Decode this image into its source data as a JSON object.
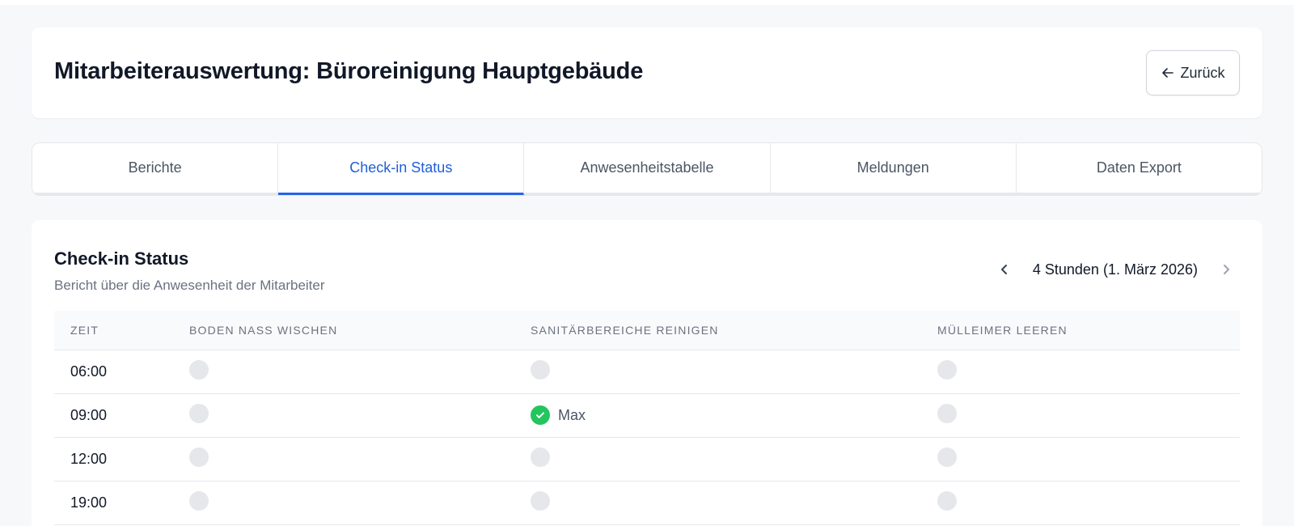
{
  "header": {
    "title": "Mitarbeiterauswertung: Büroreinigung Hauptgebäude",
    "back_label": "Zurück"
  },
  "tabs": [
    {
      "label": "Berichte",
      "active": false
    },
    {
      "label": "Check-in Status",
      "active": true
    },
    {
      "label": "Anwesenheitstabelle",
      "active": false
    },
    {
      "label": "Meldungen",
      "active": false
    },
    {
      "label": "Daten Export",
      "active": false
    }
  ],
  "section": {
    "title": "Check-in Status",
    "subtitle": "Bericht über die Anwesenheit der Mitarbeiter",
    "period_label": "4 Stunden (1. März 2026)"
  },
  "table": {
    "columns": [
      "ZEIT",
      "BODEN NASS WISCHEN",
      "SANITÄRBEREICHE REINIGEN",
      "MÜLLEIMER LEEREN"
    ],
    "rows": [
      {
        "time": "06:00",
        "cells": [
          {
            "done": false,
            "name": ""
          },
          {
            "done": false,
            "name": ""
          },
          {
            "done": false,
            "name": ""
          }
        ]
      },
      {
        "time": "09:00",
        "cells": [
          {
            "done": false,
            "name": ""
          },
          {
            "done": true,
            "name": "Max"
          },
          {
            "done": false,
            "name": ""
          }
        ]
      },
      {
        "time": "12:00",
        "cells": [
          {
            "done": false,
            "name": ""
          },
          {
            "done": false,
            "name": ""
          },
          {
            "done": false,
            "name": ""
          }
        ]
      },
      {
        "time": "19:00",
        "cells": [
          {
            "done": false,
            "name": ""
          },
          {
            "done": false,
            "name": ""
          },
          {
            "done": false,
            "name": ""
          }
        ]
      }
    ]
  },
  "colors": {
    "accent": "#2563eb",
    "check_green": "#22c55e",
    "pending_gray": "#e5e7eb"
  },
  "icons": {
    "back": "arrow-left-icon",
    "prev": "chevron-left-icon",
    "next": "chevron-right-icon",
    "done": "check-circle-icon",
    "pending": "empty-circle-icon"
  }
}
